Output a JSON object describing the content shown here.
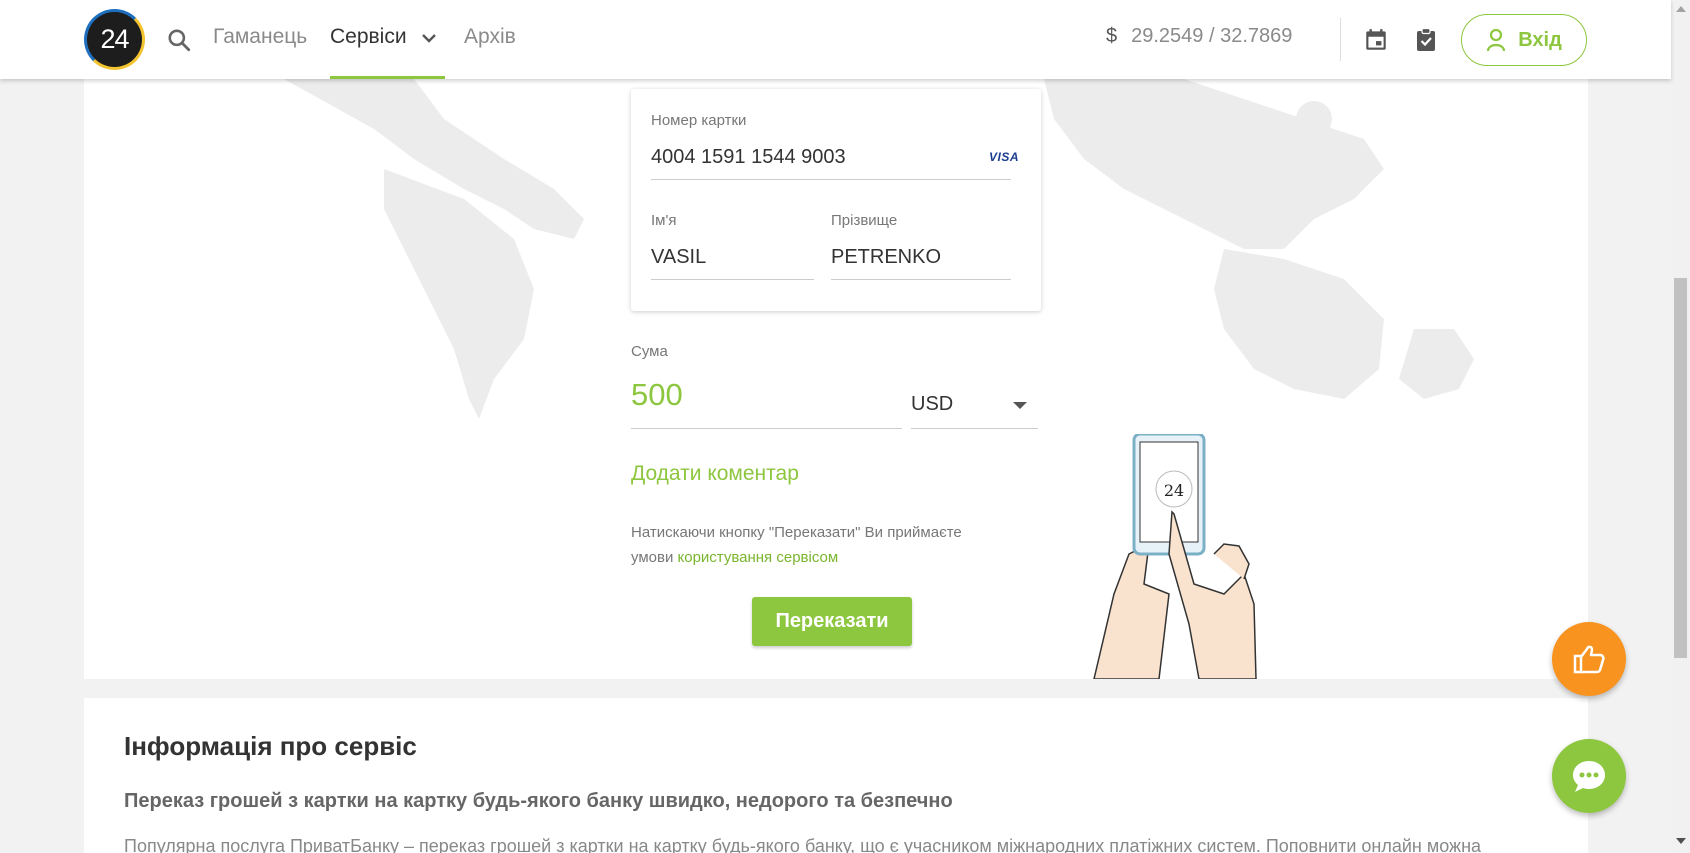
{
  "header": {
    "logo_text": "24",
    "nav": [
      {
        "label": "Гаманець"
      },
      {
        "label": "Сервіси"
      },
      {
        "label": "Архів"
      }
    ],
    "rate_currency": "$",
    "rate_value": "29.2549 / 32.7869",
    "login_label": "Вхід"
  },
  "card": {
    "number_label": "Номер картки",
    "number_value": "4004 1591 1544 9003",
    "brand": "VISA",
    "first_name_label": "Ім'я",
    "first_name_value": "VASIL",
    "last_name_label": "Прізвище",
    "last_name_value": "PETRENKO"
  },
  "amount": {
    "label": "Сума",
    "value": "500",
    "currency": "USD"
  },
  "add_comment": "Додати коментар",
  "terms": {
    "text": "Натискаючи кнопку \"Переказати\" Ви приймаєте умови ",
    "link": "користування сервісом"
  },
  "submit_label": "Переказати",
  "phone_label": "24",
  "info": {
    "title": "Інформація про сервіс",
    "subtitle": "Переказ грошей з картки на картку будь-якого банку швидко, недорого та безпечно",
    "text": "Популярна послуга ПриватБанку – переказ грошей з картки на картку будь-якого банку, що є учасником міжнародних платіжних систем. Поповнити онлайн можна"
  },
  "colors": {
    "accent": "#8dc63f",
    "orange": "#f7931e"
  }
}
